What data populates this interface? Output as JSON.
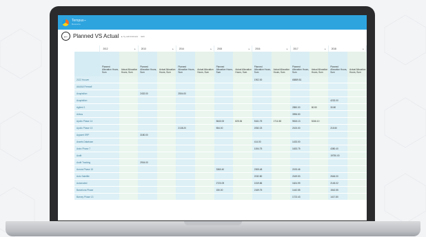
{
  "app": {
    "brand": "Tempus",
    "brand_sub": "Resource",
    "colors": {
      "accent": "#2ea4df",
      "planned_cell": "#dcf0f6",
      "actual_cell": "#eaf6ee"
    }
  },
  "page": {
    "title": "Planned VS Actual",
    "by": "by administrator",
    "edit": "Edit",
    "back_icon": "arrow-left-icon"
  },
  "years": [
    "2012",
    "2013",
    "2014",
    "2015",
    "2016",
    "2017",
    "2018"
  ],
  "column_headers": {
    "planned": "Planned Allocation Hours, Sum",
    "actual": "Actual Allocation Hours, Sum"
  },
  "rows": [
    {
      "name": "2122 Hoover",
      "cells": [
        "",
        "",
        "",
        "",
        "",
        "",
        "",
        "",
        "1902.00",
        "",
        "65889.81",
        "",
        "",
        ""
      ]
    },
    {
      "name": "AAAAA Firewall",
      "cells": [
        "",
        "",
        "",
        "",
        "",
        "",
        "",
        "",
        "",
        "",
        "",
        "",
        "",
        ""
      ]
    },
    {
      "name": "Acquisition",
      "cells": [
        "",
        "",
        "2432.00",
        "",
        "2504.00",
        "",
        "",
        "",
        "",
        "",
        "",
        "",
        "",
        ""
      ]
    },
    {
      "name": "Acquisition",
      "cells": [
        "",
        "",
        "",
        "",
        "",
        "",
        "",
        "",
        "",
        "",
        "",
        "",
        "4232.00",
        ""
      ]
    },
    {
      "name": "Agilent 1",
      "cells": [
        "",
        "",
        "",
        "",
        "",
        "",
        "",
        "",
        "",
        "",
        "2850.00",
        "80.50",
        "30.80",
        ""
      ]
    },
    {
      "name": "Airbus",
      "cells": [
        "",
        "",
        "",
        "",
        "",
        "",
        "",
        "",
        "",
        "",
        "3996.50",
        "",
        "",
        ""
      ]
    },
    {
      "name": "Apollo Phase 14",
      "cells": [
        "",
        "",
        "",
        "",
        "",
        "",
        "5640.00",
        "825.36",
        "5161.75",
        "1711.58",
        "9815.13",
        "5246.10",
        "",
        ""
      ]
    },
    {
      "name": "Apollo Phase 13",
      "cells": [
        "",
        "",
        "",
        "",
        "2138.20",
        "",
        "554.00",
        "",
        "2052.23",
        "",
        "2100.00",
        "",
        "215.50",
        ""
      ]
    },
    {
      "name": "Apparel ERP",
      "cells": [
        "",
        "",
        "3180.00",
        "",
        "",
        "",
        "",
        "",
        "",
        "",
        "",
        "",
        "",
        ""
      ]
    },
    {
      "name": "Assets Database",
      "cells": [
        "",
        "",
        "",
        "",
        "",
        "",
        "",
        "",
        "414.00",
        "",
        "1433.00",
        "",
        "",
        ""
      ]
    },
    {
      "name": "Astro Phase 7",
      "cells": [
        "",
        "",
        "",
        "",
        "",
        "",
        "",
        "",
        "1004.75",
        "",
        "1633.75",
        "",
        "4380.40",
        ""
      ]
    },
    {
      "name": "Audit",
      "cells": [
        "",
        "",
        "",
        "",
        "",
        "",
        "",
        "",
        "",
        "",
        "",
        "",
        "19750.00",
        ""
      ]
    },
    {
      "name": "Audit Tracking",
      "cells": [
        "",
        "",
        "2904.00",
        "",
        "",
        "",
        "",
        "",
        "",
        "",
        "",
        "",
        "",
        ""
      ]
    },
    {
      "name": "Aurora Phase 15",
      "cells": [
        "",
        "",
        "",
        "",
        "",
        "",
        "3360.40",
        "",
        "2305.48",
        "",
        "2193.46",
        "",
        "",
        ""
      ]
    },
    {
      "name": "Auto Satellite",
      "cells": [
        "",
        "",
        "",
        "",
        "",
        "",
        "",
        "",
        "2032.80",
        "",
        "2169.53",
        "",
        "2646.00",
        ""
      ]
    },
    {
      "name": "Automated",
      "cells": [
        "",
        "",
        "",
        "",
        "",
        "",
        "2720.09",
        "",
        "1519.86",
        "",
        "1624.99",
        "",
        "2145.02",
        ""
      ]
    },
    {
      "name": "Barcelona Phase",
      "cells": [
        "",
        "",
        "",
        "",
        "",
        "",
        "150.00",
        "",
        "2169.75",
        "",
        "1442.55",
        "",
        "1542.55",
        ""
      ]
    },
    {
      "name": "Barney Phase 13",
      "cells": [
        "",
        "",
        "",
        "",
        "",
        "",
        "",
        "",
        "",
        "",
        "1723.43",
        "",
        "1417.80",
        ""
      ]
    }
  ]
}
